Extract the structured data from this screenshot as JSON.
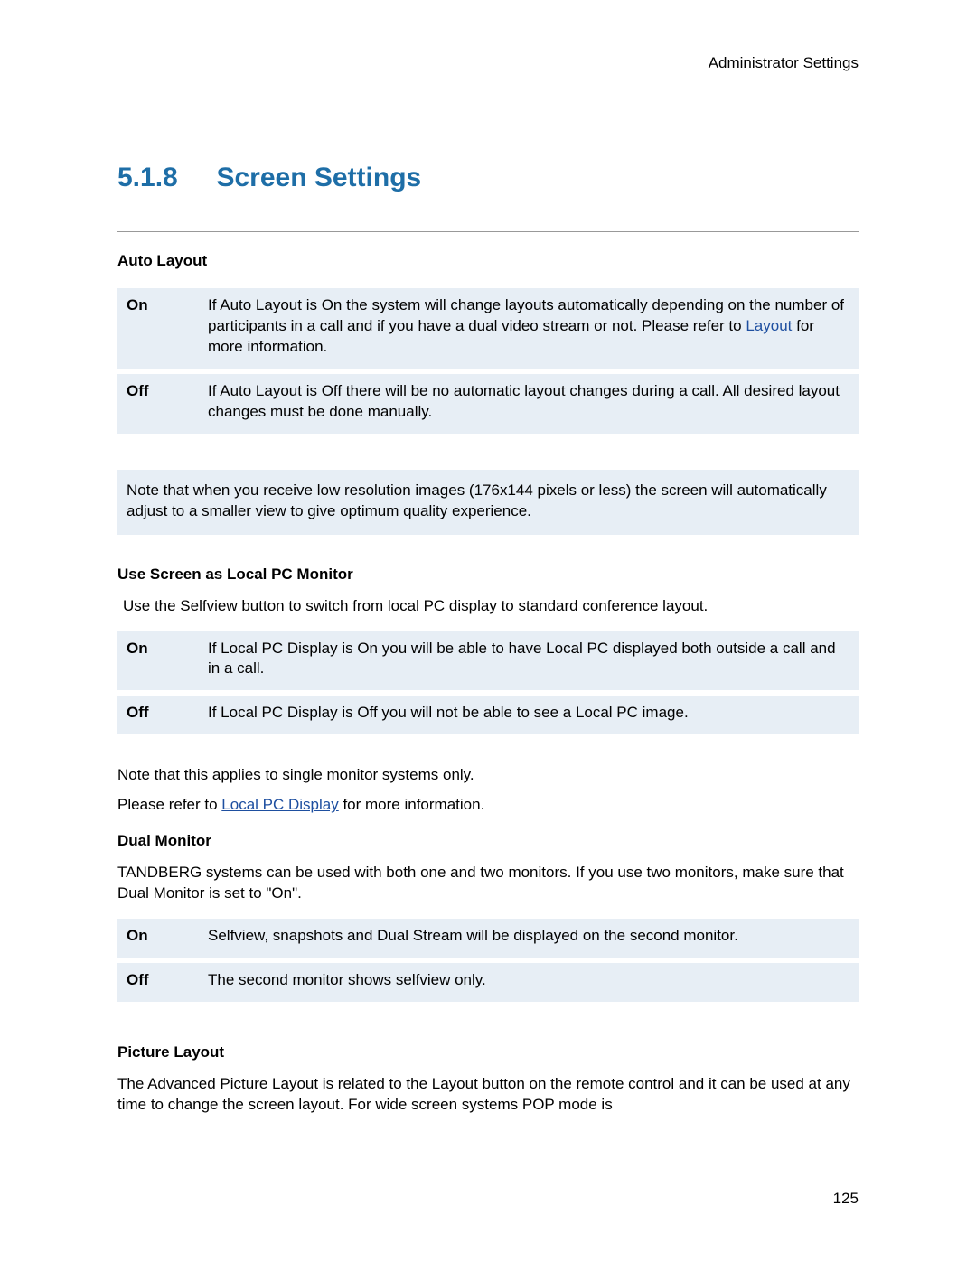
{
  "header": {
    "right": "Administrator Settings"
  },
  "section": {
    "number": "5.1.8",
    "title": "Screen Settings"
  },
  "autoLayout": {
    "label": "Auto Layout",
    "rows": [
      {
        "key": "On",
        "text_before": "If Auto Layout is On the system will change layouts automatically depending on the number of participants in a call and if you have a dual video stream or not. Please refer to ",
        "link": "Layout",
        "text_after": " for more information."
      },
      {
        "key": "Off",
        "text": "If Auto Layout is Off there will be no automatic layout changes during a call. All desired layout changes must be done manually."
      }
    ],
    "note": "Note that when you receive low resolution images (176x144 pixels or less) the screen will automatically adjust to a smaller view to give optimum quality experience."
  },
  "localPC": {
    "label": "Use Screen as Local PC Monitor",
    "intro": "Use the Selfview button to switch from local PC display to standard conference layout.",
    "rows": [
      {
        "key": "On",
        "text": "If Local PC Display is On you will be able to have Local PC displayed both outside a call and in a call."
      },
      {
        "key": "Off",
        "text": "If Local PC Display is Off you will not be able to see a Local PC image."
      }
    ],
    "note1": "Note that this applies to single monitor systems only.",
    "note2_before": "Please refer to ",
    "note2_link": "Local PC Display",
    "note2_after": " for more information."
  },
  "dualMonitor": {
    "label": "Dual Monitor",
    "intro": "TANDBERG systems can be used with both one and two monitors. If you use two monitors, make sure that Dual Monitor is set to \"On\".",
    "rows": [
      {
        "key": "On",
        "text": "Selfview, snapshots and Dual Stream will be displayed on the second monitor."
      },
      {
        "key": "Off",
        "text": "The second monitor shows selfview only."
      }
    ]
  },
  "pictureLayout": {
    "label": "Picture Layout",
    "text": "The Advanced Picture Layout is related to the Layout button on the remote control and it can be used at any time to change the screen layout. For wide screen systems POP mode is"
  },
  "pageNumber": "125"
}
